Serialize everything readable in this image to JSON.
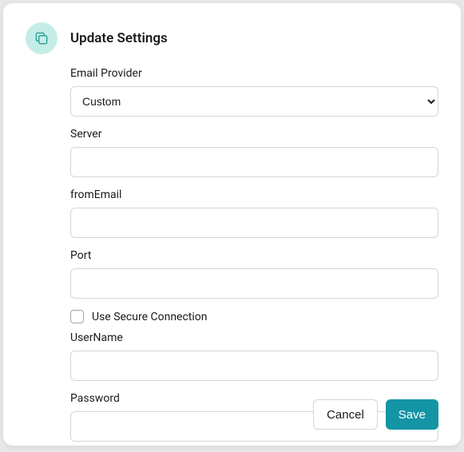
{
  "header": {
    "title": "Update Settings"
  },
  "fields": {
    "email_provider": {
      "label": "Email Provider",
      "value": "Custom"
    },
    "server": {
      "label": "Server",
      "value": ""
    },
    "from_email": {
      "label": "fromEmail",
      "value": ""
    },
    "port": {
      "label": "Port",
      "value": ""
    },
    "secure": {
      "label": "Use Secure Connection",
      "checked": false
    },
    "username": {
      "label": "UserName",
      "value": ""
    },
    "password": {
      "label": "Password",
      "value": ""
    }
  },
  "footer": {
    "cancel_label": "Cancel",
    "save_label": "Save"
  }
}
